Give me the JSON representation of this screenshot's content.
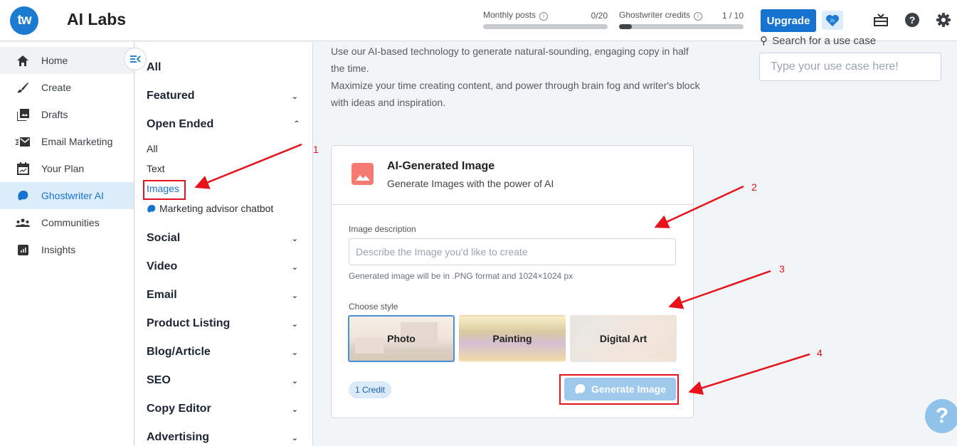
{
  "header": {
    "logo_text": "tw",
    "app_title": "AI Labs",
    "monthly_posts": {
      "label": "Monthly posts",
      "value": "0/20",
      "fraction": 0.0
    },
    "ghostwriter_credits": {
      "label": "Ghostwriter credits",
      "value": "1 / 10",
      "fraction": 0.1
    },
    "upgrade_label": "Upgrade",
    "badge_text": "2x",
    "icons": [
      "gift-icon",
      "help-icon",
      "settings-gear-icon"
    ]
  },
  "sidebar": {
    "items": [
      {
        "label": "Home",
        "icon": "home-icon",
        "state": "hover"
      },
      {
        "label": "Create",
        "icon": "brush-icon",
        "state": ""
      },
      {
        "label": "Drafts",
        "icon": "drafts-icon",
        "state": ""
      },
      {
        "label": "Email Marketing",
        "icon": "email-icon",
        "state": ""
      },
      {
        "label": "Your Plan",
        "icon": "calendar-chart-icon",
        "state": ""
      },
      {
        "label": "Ghostwriter AI",
        "icon": "ghost-icon",
        "state": "active"
      },
      {
        "label": "Communities",
        "icon": "people-icon",
        "state": ""
      },
      {
        "label": "Insights",
        "icon": "insights-icon",
        "state": ""
      }
    ]
  },
  "categories": {
    "all": "All",
    "featured": "Featured",
    "open_ended": "Open Ended",
    "open_ended_items": [
      "All",
      "Text",
      "Images",
      "Marketing advisor chatbot"
    ],
    "rest": [
      "Social",
      "Video",
      "Email",
      "Product Listing",
      "Blog/Article",
      "SEO",
      "Copy Editor",
      "Advertising"
    ]
  },
  "main": {
    "intro_line1": "Use our AI-based technology to generate natural-sounding, engaging copy in half the time.",
    "intro_line2": "Maximize your time creating content, and power through brain fog and writer's block with ideas and inspiration.",
    "search_label": "Search for a use case",
    "search_placeholder": "Type your use case here!"
  },
  "card": {
    "title": "AI-Generated Image",
    "subtitle": "Generate Images with the power of AI",
    "desc_label": "Image description",
    "desc_placeholder": "Describe the Image you'd like to create",
    "hint": "Generated image will be in .PNG format and 1024×1024 px",
    "style_label": "Choose style",
    "styles": [
      "Photo",
      "Painting",
      "Digital Art"
    ],
    "selected_style": "Photo",
    "credit": "1 Credit",
    "generate_label": "Generate Image"
  },
  "help_fab": "?",
  "annotations": [
    "1",
    "2",
    "3",
    "4"
  ],
  "colors": {
    "accent": "#1673cf",
    "annotation_red": "#e8121a",
    "card_icon": "#f47a72",
    "generate_disabled": "#9ec9ec"
  }
}
